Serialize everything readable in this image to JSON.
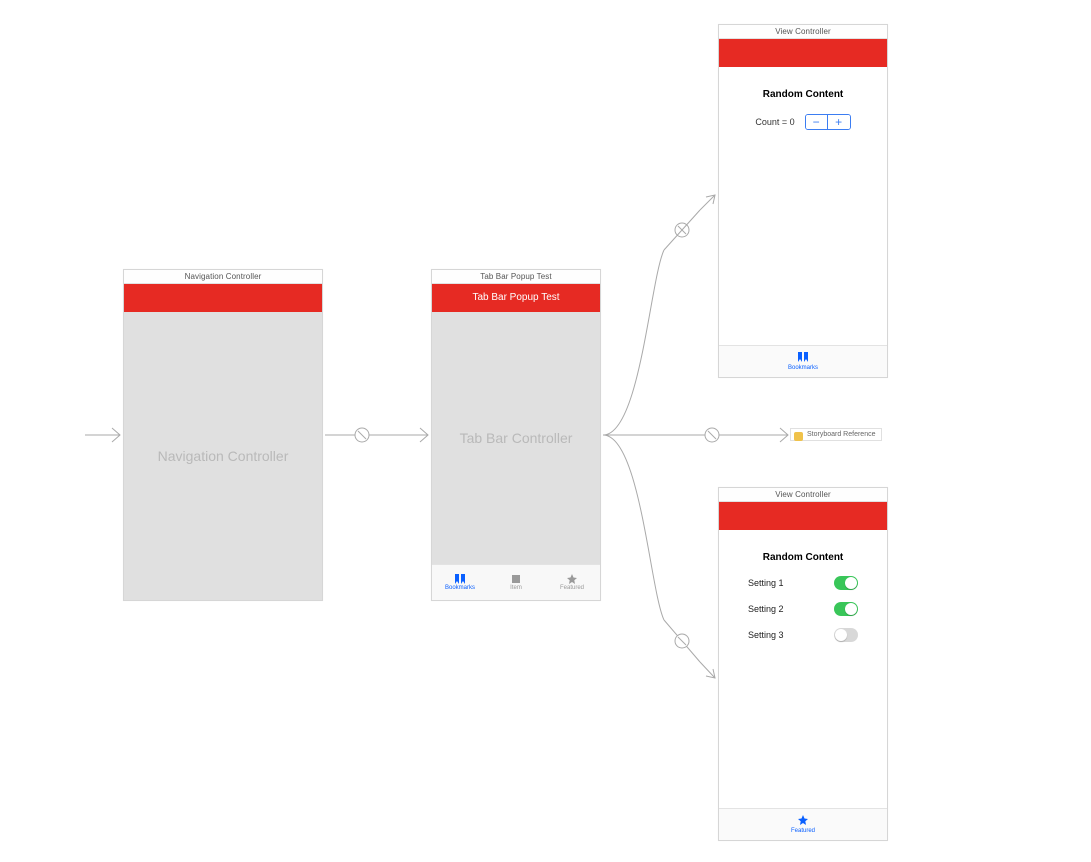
{
  "colors": {
    "accent_red": "#e62a23",
    "ios_blue": "#0a60ff",
    "switch_green": "#39c659"
  },
  "scenes": {
    "nav": {
      "title": "Navigation Controller",
      "body_label": "Navigation Controller"
    },
    "tabbar": {
      "title": "Tab Bar Popup Test",
      "nav_title": "Tab Bar Popup Test",
      "body_label": "Tab Bar Controller",
      "tabs": [
        {
          "label": "Bookmarks",
          "icon": "bookmarks",
          "selected": true
        },
        {
          "label": "Item",
          "icon": "square",
          "selected": false
        },
        {
          "label": "Featured",
          "icon": "star",
          "selected": false
        }
      ]
    },
    "vc_top": {
      "title": "View Controller",
      "heading": "Random Content",
      "count_label": "Count = 0",
      "stepper_minus": "−",
      "stepper_plus": "+",
      "tab_label": "Bookmarks"
    },
    "storyboard_ref": {
      "label": "Storyboard Reference"
    },
    "vc_bottom": {
      "title": "View Controller",
      "heading": "Random Content",
      "settings": [
        {
          "label": "Setting 1",
          "on": true
        },
        {
          "label": "Setting 2",
          "on": true
        },
        {
          "label": "Setting 3",
          "on": false
        }
      ],
      "tab_label": "Featured"
    }
  }
}
